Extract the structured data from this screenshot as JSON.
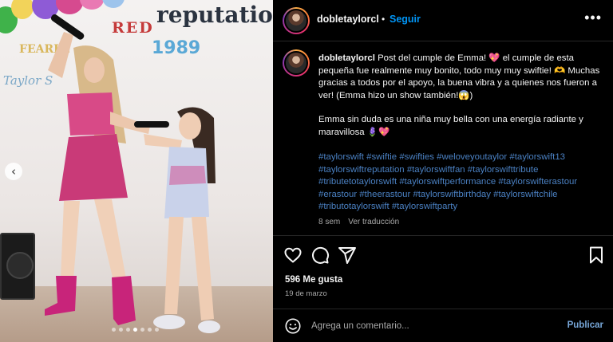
{
  "post_image": {
    "wall_text_red": "RED",
    "wall_text_reputation": "reputation",
    "wall_text_1989": "1989",
    "wall_text_fearless": "FEARLE",
    "wall_text_taylor": "Taylor S",
    "carousel_prev": "‹",
    "dots_total": 7,
    "dots_active_index": 3
  },
  "header": {
    "username": "dobletaylorcl",
    "separator": "•",
    "follow_label": "Seguir",
    "more_label": "•••"
  },
  "caption": {
    "username": "dobletaylorcl",
    "line1": "Post del cumple de Emma! 💖  el cumple de esta pequeña fue realmente muy bonito, todo muy muy swiftie! 🫶 Muchas gracias a todos por el apoyo, la buena vibra y a quienes nos fueron a ver! (Emma hizo un show también!😱)",
    "line2": "Emma sin duda es una niña muy bella con una energía radiante y maravillosa 🪻💖",
    "hashtags": [
      "#taylorswift",
      "#swiftie",
      "#swifties",
      "#weloveyoutaylor",
      "#taylorswift13",
      "#taylorswiftreputation",
      "#taylorswiftfan",
      "#taylorswifttribute",
      "#tributetotaylorswift",
      "#taylorswiftperformance",
      "#taylorswifterastour",
      "#erastour",
      "#theerastour",
      "#taylorswiftbirthday",
      "#taylorswiftchile",
      "#tributotaylorswift",
      "#taylorswiftparty"
    ],
    "time_ago": "8 sem",
    "translate_label": "Ver traducción"
  },
  "engagement": {
    "likes": "596 Me gusta",
    "date": "19 de marzo"
  },
  "comment": {
    "placeholder": "Agrega un comentario...",
    "publish_label": "Publicar"
  },
  "icons": {
    "like": "heart-icon",
    "comment": "comment-icon",
    "share": "share-icon",
    "save": "bookmark-icon",
    "emoji": "emoji-icon"
  },
  "colors": {
    "background": "#000000",
    "link_blue": "#0095f6",
    "hashtag_blue": "#4a80c2",
    "muted_text": "#a8a8a8"
  }
}
